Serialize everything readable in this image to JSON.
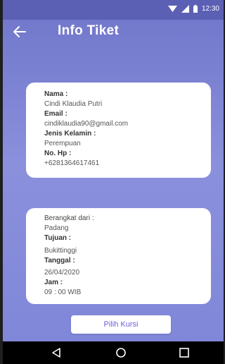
{
  "status_bar": {
    "time": "12:30"
  },
  "app_bar": {
    "title": "Info Tiket"
  },
  "passenger": {
    "name_label": "Nama :",
    "name_value": "Cindi Klaudia Putri",
    "email_label": "Email :",
    "email_value": "cindiklaudia90@gmail.com",
    "gender_label": "Jenis Kelamin :",
    "gender_value": "Perempuan",
    "phone_label": "No. Hp :",
    "phone_value": "+6281364617461"
  },
  "trip": {
    "from_label": "Berangkat dari :",
    "from_value": "Padang",
    "to_label": "Tujuan :",
    "to_value": "Bukittinggi",
    "date_label": "Tanggal :",
    "date_value": "26/04/2020",
    "time_label": "Jam :",
    "time_value": "09 : 00 WIB"
  },
  "actions": {
    "choose_seat": "Pilih Kursi"
  },
  "icons": {
    "back": "arrow-left-icon",
    "wifi": "wifi-icon",
    "signal": "signal-icon",
    "battery": "battery-icon",
    "nav_back": "triangle-back-icon",
    "nav_home": "circle-home-icon",
    "nav_recent": "square-recent-icon"
  }
}
